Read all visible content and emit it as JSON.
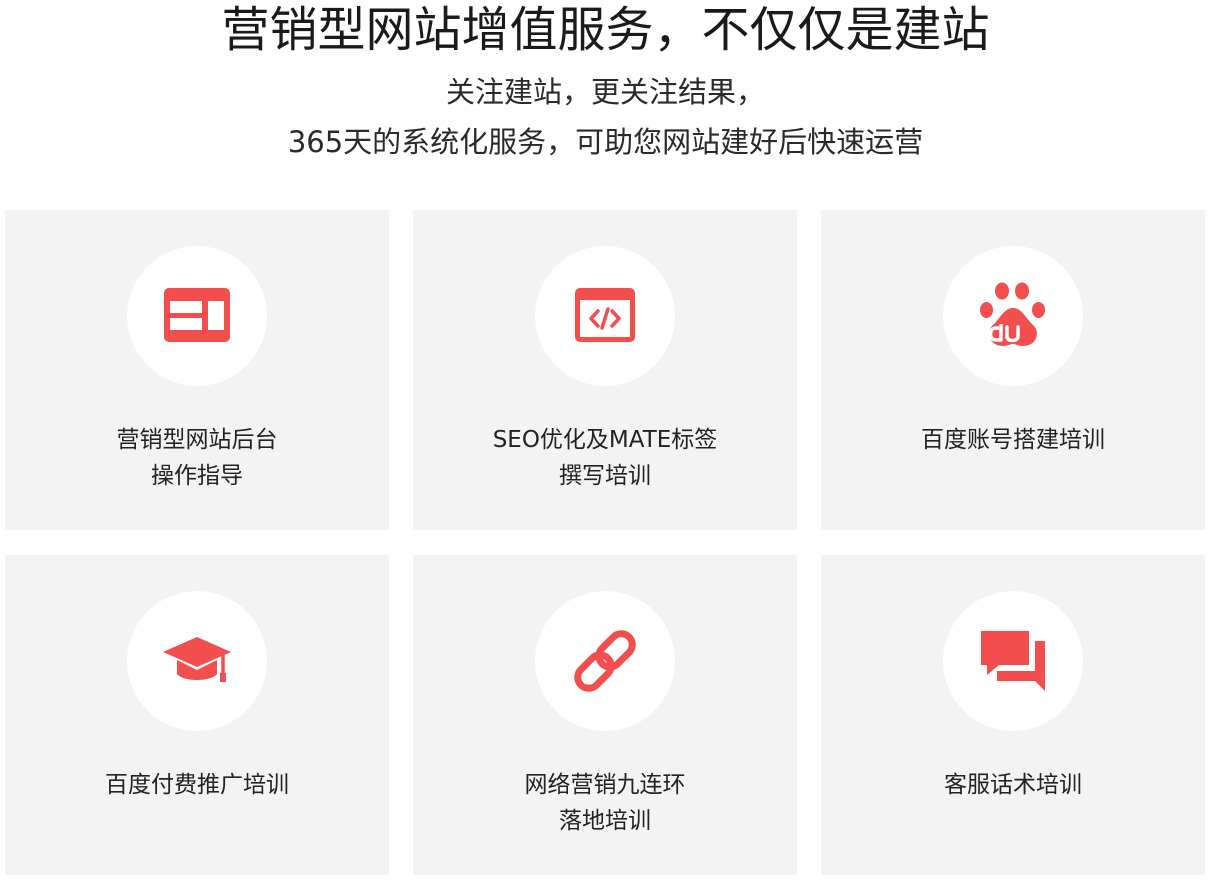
{
  "header": {
    "title": "营销型网站增值服务，不仅仅是建站",
    "subtitle_line1": "关注建站，更关注结果，",
    "subtitle_line2": "365天的系统化服务，可助您网站建好后快速运营"
  },
  "colors": {
    "accent": "#f24e4e",
    "card_bg": "#f3f3f3",
    "circle_bg": "#ffffff"
  },
  "services": [
    {
      "icon": "layout-icon",
      "line1": "营销型网站后台",
      "line2": "操作指导"
    },
    {
      "icon": "code-icon",
      "line1": "SEO优化及MATE标签",
      "line2": "撰写培训"
    },
    {
      "icon": "baidu-paw-icon",
      "line1": "百度账号搭建培训",
      "line2": ""
    },
    {
      "icon": "graduation-cap-icon",
      "line1": "百度付费推广培训",
      "line2": ""
    },
    {
      "icon": "link-icon",
      "line1": "网络营销九连环",
      "line2": "落地培训"
    },
    {
      "icon": "chat-bubbles-icon",
      "line1": "客服话术培训",
      "line2": ""
    }
  ]
}
